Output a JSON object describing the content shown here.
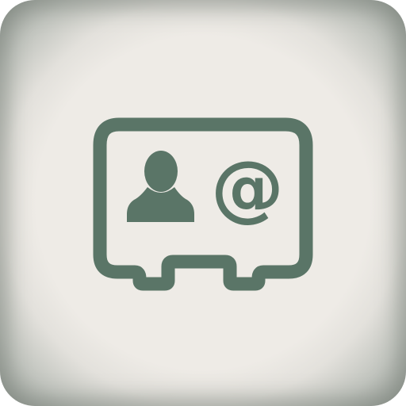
{
  "icon": {
    "name": "contact-card-icon",
    "at_symbol": "@",
    "colors": {
      "glyph": "#5a7567",
      "background": "#eeebe6",
      "edge": "#8f968f"
    }
  }
}
